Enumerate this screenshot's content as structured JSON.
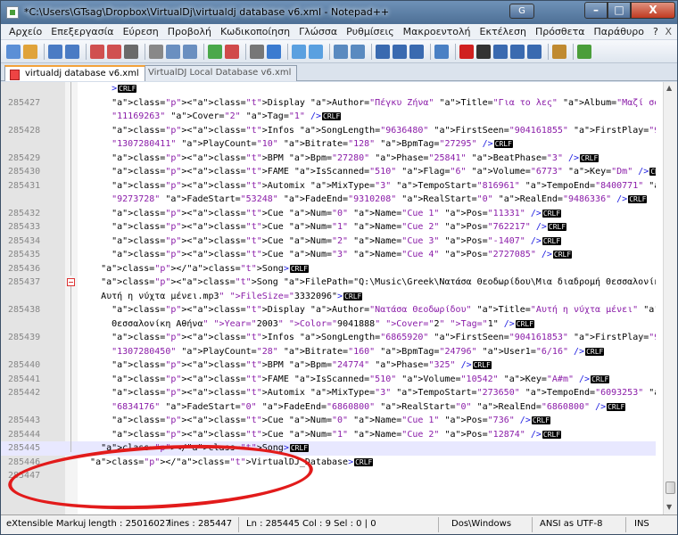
{
  "window": {
    "title": "*C:\\Users\\GTsag\\Dropbox\\VirtualDj\\virtualdj database v6.xml - Notepad++",
    "extra_button": "G",
    "buttons": {
      "minimize": "–",
      "maximize": "□",
      "close": "X"
    }
  },
  "menu": {
    "items": [
      "Αρχείο",
      "Επεξεργασία",
      "Εύρεση",
      "Προβολή",
      "Κωδικοποίηση",
      "Γλώσσα",
      "Ρυθμίσεις",
      "Μακροεντολή",
      "Εκτέλεση",
      "Πρόσθετα",
      "Παράθυρο",
      "?"
    ],
    "close_label": "X"
  },
  "toolbar": {
    "icons": [
      "new-file-icon",
      "open-file-icon",
      "save-icon",
      "save-all-icon",
      "close-icon",
      "close-all-icon",
      "print-icon",
      "cut-icon",
      "copy-icon",
      "paste-icon",
      "undo-icon",
      "redo-icon",
      "find-icon",
      "replace-icon",
      "zoom-in-icon",
      "zoom-out-icon",
      "sync-v-icon",
      "sync-h-icon",
      "word-wrap-icon",
      "all-chars-icon",
      "indent-guide-icon",
      "folder-icon",
      "record-icon",
      "stop-icon",
      "play-icon",
      "play-multi-icon",
      "save-macro-icon",
      "run-icon",
      "spellcheck-icon"
    ]
  },
  "tabs": [
    {
      "label": "virtualdj database v6.xml",
      "active": true
    },
    {
      "label": "VirtualDJ Local Database v6.xml",
      "active": false
    }
  ],
  "editor": {
    "eol_label": "CRLF",
    "current_line": 285445,
    "lines": [
      {
        "n": "",
        "code": "      >"
      },
      {
        "n": "285427",
        "code": "      <Display Author=\"Πέγκυ Ζήνα\" Title=\"Για το λες\" Album=\"Μαζί σου\" Year=\"2003\" Color="
      },
      {
        "n": "",
        "code": "      \"11169263\" Cover=\"2\" Tag=\"1\" />"
      },
      {
        "n": "285428",
        "code": "      <Infos SongLength=\"9636480\" FirstSeen=\"904161855\" FirstPlay=\"912102241\" LastPlay="
      },
      {
        "n": "",
        "code": "      \"1307280411\" PlayCount=\"10\" Bitrate=\"128\" BpmTag=\"27295\" />"
      },
      {
        "n": "285429",
        "code": "      <BPM Bpm=\"27280\" Phase=\"25841\" BeatPhase=\"3\" />"
      },
      {
        "n": "285430",
        "code": "      <FAME IsScanned=\"510\" Flag=\"6\" Volume=\"6773\" Key=\"Dm\" />"
      },
      {
        "n": "285431",
        "code": "      <Automix MixType=\"3\" TempoStart=\"816961\" TempoEnd=\"8400771\" CutStart=\"762400\" CutEnd="
      },
      {
        "n": "",
        "code": "      \"9273728\" FadeStart=\"53248\" FadeEnd=\"9310208\" RealStart=\"0\" RealEnd=\"9486336\" />"
      },
      {
        "n": "285432",
        "code": "      <Cue Num=\"0\" Name=\"Cue 1\" Pos=\"11331\" />"
      },
      {
        "n": "285433",
        "code": "      <Cue Num=\"1\" Name=\"Cue 2\" Pos=\"762217\" />"
      },
      {
        "n": "285434",
        "code": "      <Cue Num=\"2\" Name=\"Cue 3\" Pos=\"-1407\" />"
      },
      {
        "n": "285435",
        "code": "      <Cue Num=\"3\" Name=\"Cue 4\" Pos=\"2727085\" />"
      },
      {
        "n": "285436",
        "code": "    </Song>"
      },
      {
        "n": "285437",
        "code": "    <Song FilePath=\"Q:\\Music\\Greek\\Νατάσα Θεοδωρίδου\\Μια διαδρομή Θεσσαλονίκη Αθήνα\\B06 -"
      },
      {
        "n": "",
        "code": "    Αυτή η νύχτα μένει.mp3\" FileSize=\"3332096\">"
      },
      {
        "n": "285438",
        "code": "      <Display Author=\"Νατάσα Θεοδωρίδου\" Title=\"Αυτή η νύχτα μένει\" Album=\"Μια διαδρομή"
      },
      {
        "n": "",
        "code": "      Θεσσαλονίκη Αθήνα\" Year=\"2003\" Color=\"9041888\" Cover=\"2\" Tag=\"1\" />"
      },
      {
        "n": "285439",
        "code": "      <Infos SongLength=\"6865920\" FirstSeen=\"904161853\" FirstPlay=\"908220426\" LastPlay="
      },
      {
        "n": "",
        "code": "      \"1307280450\" PlayCount=\"28\" Bitrate=\"160\" BpmTag=\"24796\" User1=\"6/16\" />"
      },
      {
        "n": "285440",
        "code": "      <BPM Bpm=\"24774\" Phase=\"325\" />"
      },
      {
        "n": "285441",
        "code": "      <FAME IsScanned=\"510\" Volume=\"10542\" Key=\"A#m\" />"
      },
      {
        "n": "285442",
        "code": "      <Automix MixType=\"3\" TempoStart=\"273650\" TempoEnd=\"6093253\" CutStart=\"13984\" CutEnd="
      },
      {
        "n": "",
        "code": "      \"6834176\" FadeStart=\"0\" FadeEnd=\"6860800\" RealStart=\"0\" RealEnd=\"6860800\" />"
      },
      {
        "n": "285443",
        "code": "      <Cue Num=\"0\" Name=\"Cue 1\" Pos=\"736\" />"
      },
      {
        "n": "285444",
        "code": "      <Cue Num=\"1\" Name=\"Cue 2\" Pos=\"12874\" />"
      },
      {
        "n": "285445",
        "code": "    </Song>"
      },
      {
        "n": "285446",
        "code": "  </VirtualDJ_Database>"
      },
      {
        "n": "285447",
        "code": ""
      }
    ]
  },
  "status": {
    "filetype": "eXtensible Markuj",
    "length": "length : 25016027",
    "lines": "lines : 285447",
    "position": "Ln : 285445   Col : 9   Sel : 0 | 0",
    "eol": "Dos\\Windows",
    "encoding": "ANSI as UTF-8",
    "mode": "INS"
  },
  "colors": {
    "tag": "#1c1ce0",
    "attribute": "#c04040",
    "value": "#8a1ca8",
    "annotation": "#e21b1b"
  }
}
